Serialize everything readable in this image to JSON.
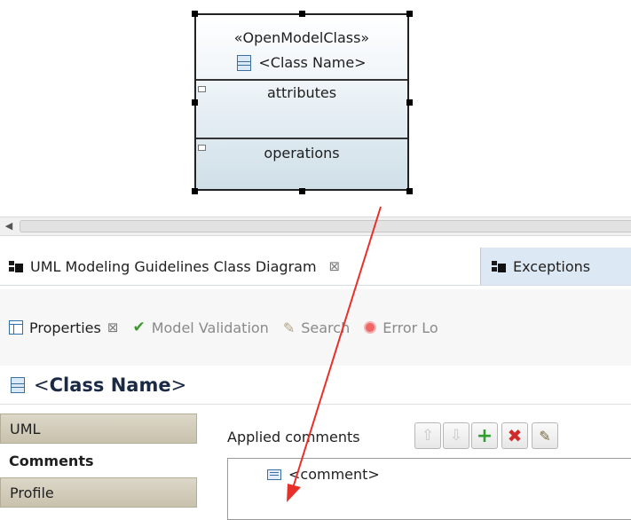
{
  "uml_class": {
    "stereotype": "«OpenModelClass»",
    "name": "<Class Name>",
    "attributes_label": "attributes",
    "operations_label": "operations"
  },
  "editor_tabs": [
    {
      "label": "UML Modeling Guidelines Class Diagram",
      "icon": "class-diagram-icon",
      "close": "⊠"
    },
    {
      "label": "Exceptions",
      "icon": "class-diagram-icon"
    }
  ],
  "view_tabs": [
    {
      "label": "Properties",
      "icon": "properties-icon",
      "close": "⊠"
    },
    {
      "label": "Model Validation",
      "icon": "check-icon"
    },
    {
      "label": "Search",
      "icon": "search-icon"
    },
    {
      "label": "Error Lo",
      "icon": "error-log-icon"
    }
  ],
  "properties_title": {
    "prefix": "<",
    "bold": "Class Name",
    "suffix": ">"
  },
  "sections": [
    "UML",
    "Comments",
    "Profile"
  ],
  "applied_comments": {
    "label": "Applied comments",
    "items": [
      "<comment>"
    ]
  },
  "colors": {
    "arrow": "#e8302a",
    "selected_tab_bg": "#dce8f4",
    "section_bg": "#c8c1ac"
  }
}
